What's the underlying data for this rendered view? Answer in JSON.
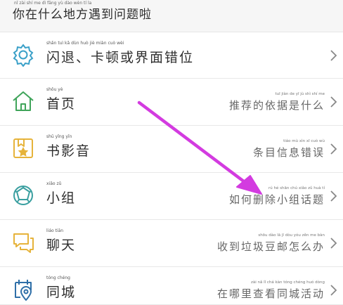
{
  "header": {
    "title_pinyin": "nǐ zài shí me dì fāng yù dào wèn tí la",
    "title": "你在什么地方遇到问题啦"
  },
  "items": [
    {
      "label_pinyin": "shǎn tuì   kǎ dùn huò jiè miàn cuò wèi",
      "label": "闪退、卡顿或界面错位",
      "hint_pinyin": "",
      "hint": "",
      "icon": "gear-icon",
      "icon_color": "#3aa0c8"
    },
    {
      "label_pinyin": "shǒu yè",
      "label": "首页",
      "hint_pinyin": "tuī jiàn de yī jù shì shí me",
      "hint": "推荐的依据是什么",
      "icon": "home-icon",
      "icon_color": "#3fa45a"
    },
    {
      "label_pinyin": "shū yǐng yīn",
      "label": "书影音",
      "hint_pinyin": "tiáo mù xìn xī cuò wù",
      "hint": "条目信息错误",
      "icon": "bookmark-star-icon",
      "icon_color": "#e6b33a"
    },
    {
      "label_pinyin": "xiǎo zǔ",
      "label": "小组",
      "hint_pinyin": "rú hé shān chú xiǎo zǔ huà tí",
      "hint": "如何删除小组话题",
      "icon": "group-icon",
      "icon_color": "#3a9fa0"
    },
    {
      "label_pinyin": "liáo tiān",
      "label": "聊天",
      "hint_pinyin": "shōu dào lā jī dòu yóu zěn me bàn",
      "hint": "收到垃圾豆邮怎么办",
      "icon": "chat-icon",
      "icon_color": "#e6b33a"
    },
    {
      "label_pinyin": "tóng chéng",
      "label": "同城",
      "hint_pinyin": "zài nǎ lǐ chá kàn tóng chéng huó dòng",
      "hint": "在哪里查看同城活动",
      "icon": "location-calendar-icon",
      "icon_color": "#2f6fa8"
    }
  ],
  "overlay": {
    "annotation": "magenta-arrow",
    "color": "#d33be0"
  }
}
